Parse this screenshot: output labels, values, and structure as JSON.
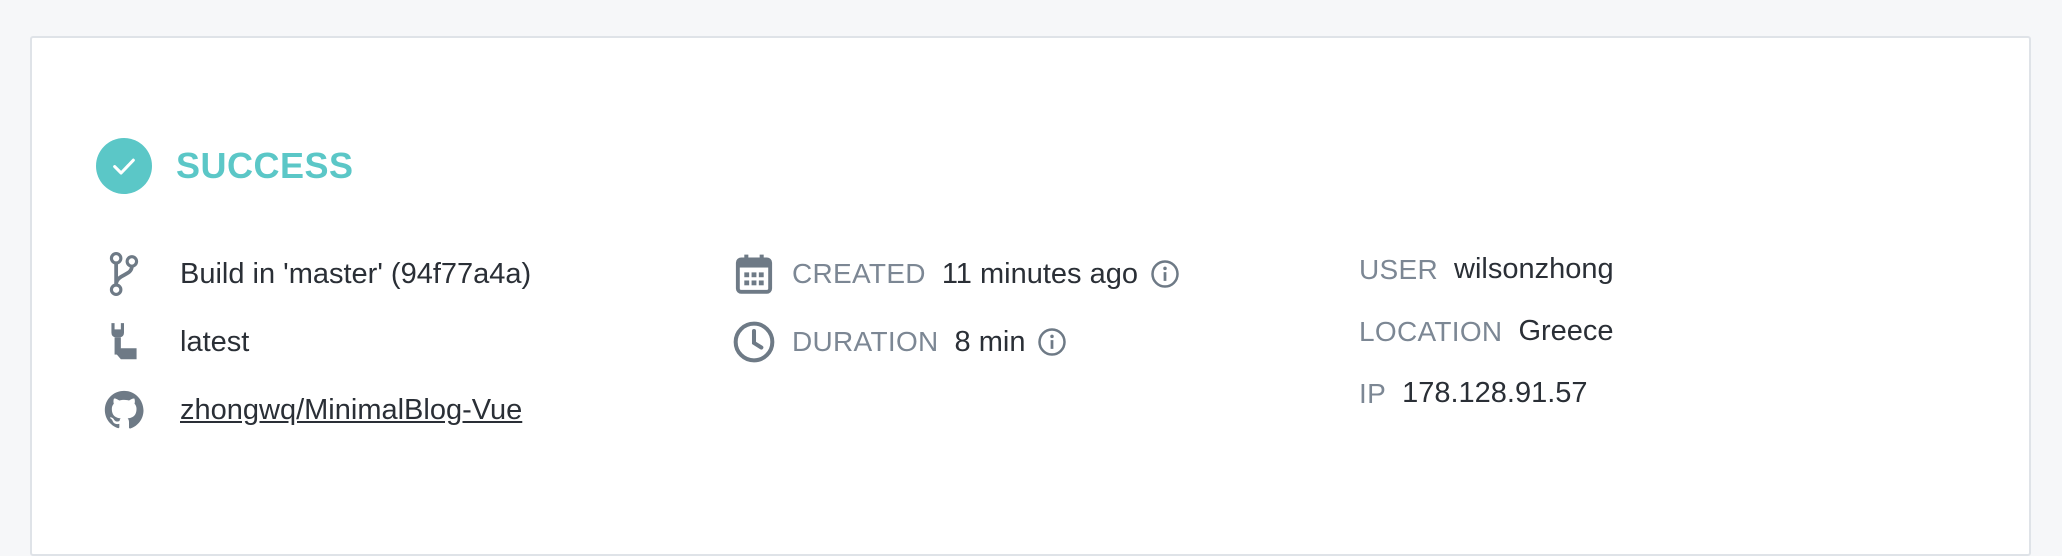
{
  "status": {
    "label": "SUCCESS",
    "icon": "check-circle-icon",
    "color": "#5bc7c7"
  },
  "build": {
    "branch_text": "Build in 'master' (94f77a4a)",
    "tag": "latest",
    "repo_link": "zhongwq/MinimalBlog-Vue"
  },
  "timing": {
    "created_key": "CREATED",
    "created_value": "11 minutes ago",
    "duration_key": "DURATION",
    "duration_value": "8 min"
  },
  "meta": {
    "user_key": "USER",
    "user_value": "wilsonzhong",
    "location_key": "LOCATION",
    "location_value": "Greece",
    "ip_key": "IP",
    "ip_value": "178.128.91.57"
  },
  "icons": {
    "branch": "git-branch-icon",
    "tag": "wrench-tag-icon",
    "repo": "github-icon",
    "created": "calendar-icon",
    "duration": "clock-icon",
    "info": "info-icon"
  }
}
